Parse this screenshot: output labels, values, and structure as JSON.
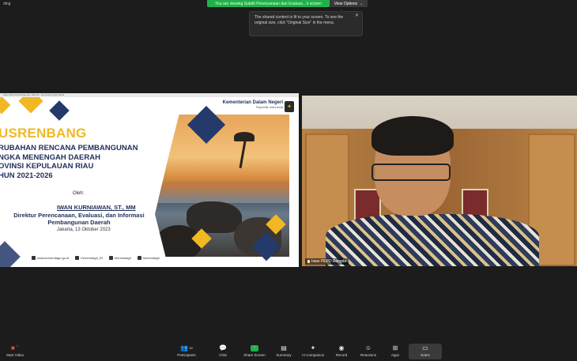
{
  "topbar": {
    "left_label": "ding",
    "viewing": "You are viewing Subdit Perencanaan dan Evaluas...'s screen",
    "view_options": "View Options"
  },
  "tooltip": {
    "text": "The shared content is fit to your screen. To see the original size, click \"Original Size\" in the menu."
  },
  "slide": {
    "window_title": "Ditjen Bina Pembangunan Daerah - Rencana Kerja Subdit",
    "org_name": "Kementerian Dalam Negeri",
    "org_sub": "Republik Indonesia",
    "title": "USRENBANG",
    "subtitle_lines": [
      "RUBAHAN RENCANA PEMBANGUNAN",
      "NGKA MENENGAH DAERAH",
      "OVINSI KEPULAUAN RIAU",
      "HUN 2021-2026"
    ],
    "oleh": "Oleh:",
    "speaker_name": "IWAN KURNIAWAN, ST., MM",
    "speaker_position_1": "Direktur Perencanaan, Evaluasi, dan Informasi",
    "speaker_position_2": "Pembangunan Daerah",
    "date": "Jakarta, 13 Oktober 2023",
    "social": [
      "www.kemendagri.go.id",
      "Kemendagri_RI",
      "kemendagri",
      "kemendagri"
    ]
  },
  "camera": {
    "participant_label": "Isian PEPD Bangda"
  },
  "toolbar": {
    "start_video": "Start Video",
    "participants": "Participants",
    "participants_count": "28",
    "chat": "Chat",
    "share_screen": "Share Screen",
    "summary": "Summary",
    "ai_companion": "AI Companion",
    "record": "Record",
    "reactions": "Reactions",
    "apps": "Apps",
    "notes": "Notes"
  }
}
